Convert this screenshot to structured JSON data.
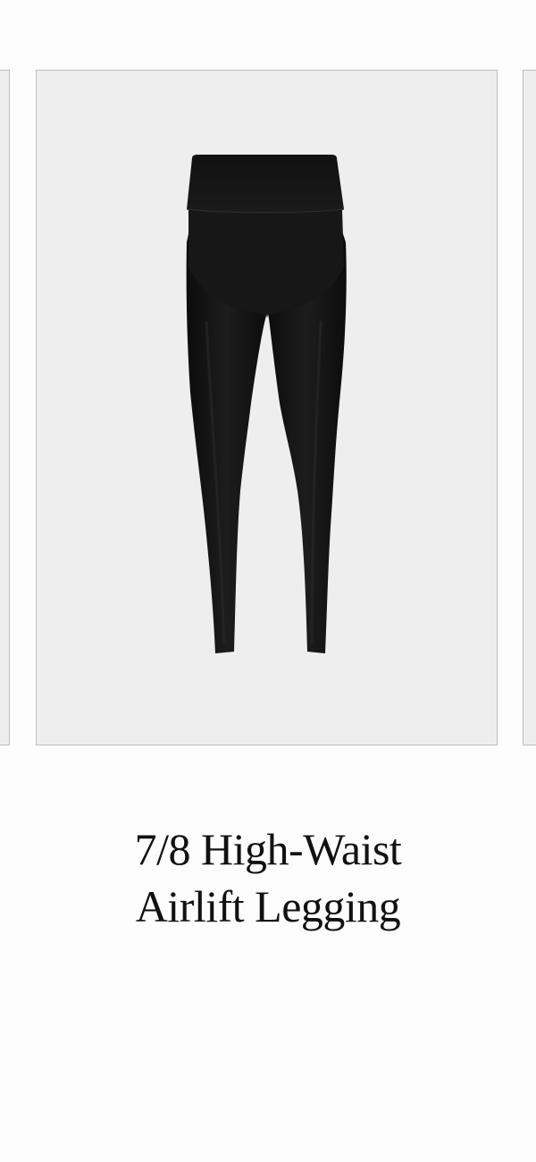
{
  "product": {
    "title_line_1": "7/8 High-Waist",
    "title_line_2": "Airlift Legging",
    "image_subject": "black high-waist legging",
    "garment_color": "#151515"
  },
  "carousel": {
    "card_background": "#eeeeee",
    "card_border": "#bdbdbd"
  }
}
